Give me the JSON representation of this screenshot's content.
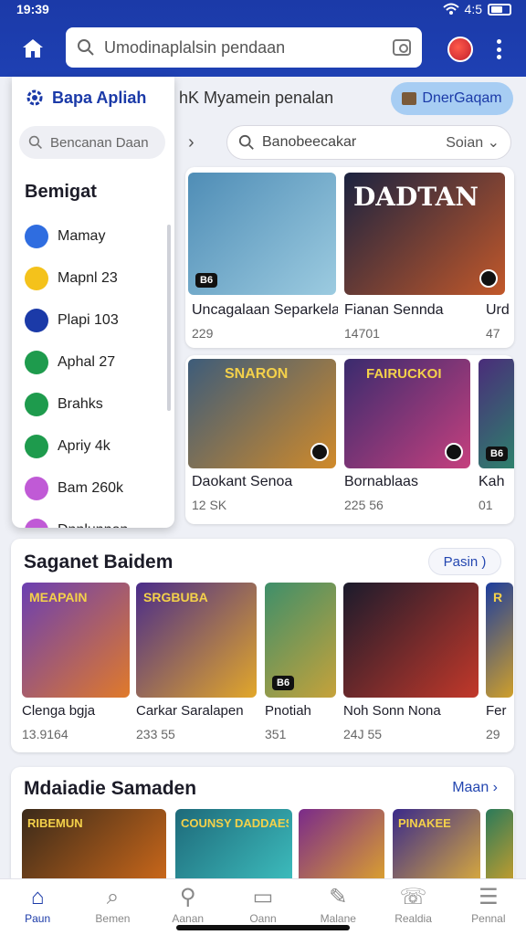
{
  "status": {
    "time": "19:39",
    "network": "4:5"
  },
  "search": {
    "placeholder": "Umodinaplalsin pendaan"
  },
  "header": {
    "subtitle": "hK Myamein penalan",
    "promo_label": "DnerGaqam"
  },
  "filter": {
    "placeholder": "Banobeecakar",
    "sort_label": "Soian"
  },
  "drawer": {
    "title": "Bapa Apliah",
    "search_placeholder": "Bencanan Daan",
    "heading": "Bemigat",
    "items": [
      {
        "label": "Mamay",
        "icon": "globe-icon",
        "color": "#2f6de0"
      },
      {
        "label": "Mapnl 23",
        "icon": "smile-icon",
        "color": "#f4c21b"
      },
      {
        "label": "Plapi 103",
        "icon": "plane-icon",
        "color": "#1b3aa8"
      },
      {
        "label": "Aphal 27",
        "icon": "list-icon",
        "color": "#1e9b4d"
      },
      {
        "label": "Brahks",
        "icon": "shield-icon",
        "color": "#1e9b4d"
      },
      {
        "label": "Apriy 4k",
        "icon": "tag-icon",
        "color": "#1e9b4d"
      },
      {
        "label": "Bam 260k",
        "icon": "gift-icon",
        "color": "#c05ad6"
      },
      {
        "label": "Dnnlunnon",
        "icon": "folder-icon",
        "color": "#c05ad6"
      }
    ]
  },
  "grid": {
    "row1": [
      {
        "name": "Uncagalaan Separkela",
        "count": "229",
        "badge": "B6",
        "c1": "#4f8db6",
        "c2": "#9ccbe0"
      },
      {
        "name": "Fianan Sennda",
        "count": "14701",
        "title": "DADTAN",
        "c1": "#1b2340",
        "c2": "#c2582a"
      },
      {
        "name": "Urd",
        "count": "47",
        "c1": "#1b2340",
        "c2": "#3e5fa8"
      }
    ],
    "row2": [
      {
        "name": "Daokant Senoa",
        "count": "12 SK",
        "title": "SNARON",
        "c1": "#3d5c7a",
        "c2": "#d08a2a"
      },
      {
        "name": "Bornablaas",
        "count": "225 56",
        "title": "FAIRUCKOI",
        "c1": "#3a2b6e",
        "c2": "#c5407e"
      },
      {
        "name": "Kah",
        "count": "01",
        "badge": "B6",
        "c1": "#4a2c7a",
        "c2": "#2a8c6a"
      }
    ]
  },
  "section1": {
    "title": "Saganet Baidem",
    "more_label": "Pasin )",
    "items": [
      {
        "name": "Clenga bgja",
        "count": "13.9164",
        "title": "MEAPAIN",
        "c1": "#6b3fb2",
        "c2": "#e07a2a"
      },
      {
        "name": "Carkar Saralapen",
        "count": "233 55",
        "title": "SRGBUBA",
        "c1": "#4a2c8a",
        "c2": "#e2a72a"
      },
      {
        "name": "Pnotiah",
        "count": "351",
        "badge": "B6",
        "c1": "#3e8f6a",
        "c2": "#c6a23a"
      },
      {
        "name": "Noh Sonn Nona",
        "count": "24J 55",
        "c1": "#1b1b2c",
        "c2": "#c2382a"
      },
      {
        "name": "Fer",
        "count": "29",
        "title": "R",
        "c1": "#1c3d9e",
        "c2": "#d0a02a"
      }
    ]
  },
  "section2": {
    "title": "Mdaiadie Samaden",
    "more_label": "Maan ›",
    "items": [
      {
        "title": "RIBEMUN",
        "c1": "#3a2a1a",
        "c2": "#d06a1a"
      },
      {
        "title": "COUNSY DADDAES",
        "c1": "#1e6a7a",
        "c2": "#3ec0c0"
      },
      {
        "title": "",
        "c1": "#7a2a8a",
        "c2": "#e0a72a"
      },
      {
        "title": "PINAKEE",
        "c1": "#3a2a8a",
        "c2": "#e0b03a"
      },
      {
        "title": "",
        "c1": "#2a7a5a",
        "c2": "#d0a02a"
      }
    ]
  },
  "nav": [
    {
      "label": "Paun",
      "icon": "home-icon",
      "active": true
    },
    {
      "label": "Bemen",
      "icon": "search-icon",
      "active": false
    },
    {
      "label": "Aanan",
      "icon": "location-icon",
      "active": false
    },
    {
      "label": "Oann",
      "icon": "tablet-icon",
      "active": false
    },
    {
      "label": "Malane",
      "icon": "pen-icon",
      "active": false
    },
    {
      "label": "Realdia",
      "icon": "chat-icon",
      "active": false
    },
    {
      "label": "Pennal",
      "icon": "menu-icon",
      "active": false
    }
  ]
}
